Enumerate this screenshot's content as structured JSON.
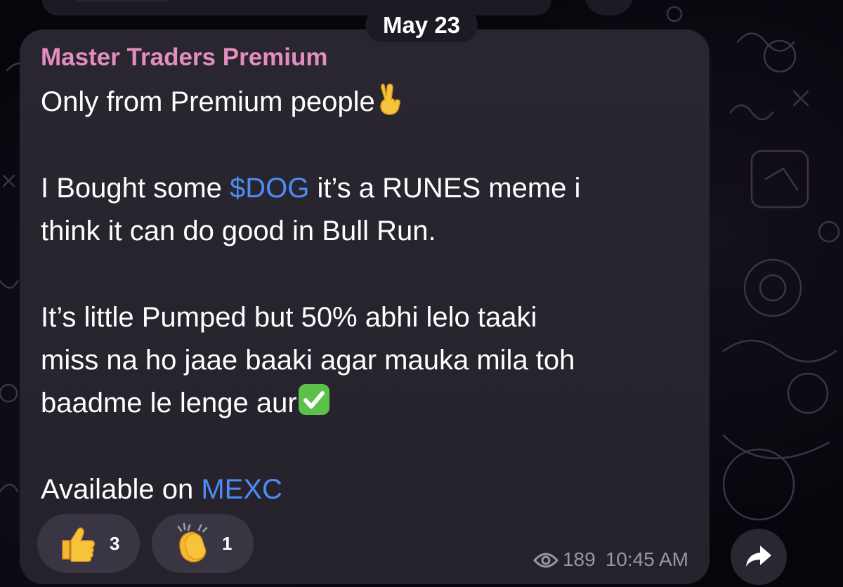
{
  "date_separator": "May 23",
  "message": {
    "sender": "Master Traders Premium",
    "lines": {
      "l1": "Only from Premium people",
      "l2_before": "I Bought some ",
      "l2_link": "$DOG",
      "l2_after": " it’s a RUNES meme i",
      "l3": "think it can do good in Bull Run.",
      "l4": "It’s little Pumped but 50% abhi lelo taaki",
      "l5": "miss na ho jaae baaki agar mauka mila toh",
      "l6": "baadme le lenge aur",
      "l7_before": "Available on ",
      "l7_link": "MEXC"
    },
    "views": "189",
    "time": "10:45 AM"
  },
  "reactions": [
    {
      "icon": "thumbs-up-icon",
      "count": "3"
    },
    {
      "icon": "clapping-hands-icon",
      "count": "1"
    }
  ],
  "colors": {
    "sender": "#e48ec0",
    "link": "#4d8cf5",
    "bubble": "#2a2630",
    "reaction_bg": "#3a3542",
    "meta": "#9a95a3"
  },
  "icons": {
    "victory": "victory-hand-emoji",
    "check": "check-mark-emoji",
    "views": "eye-icon",
    "share": "share-arrow-icon"
  }
}
